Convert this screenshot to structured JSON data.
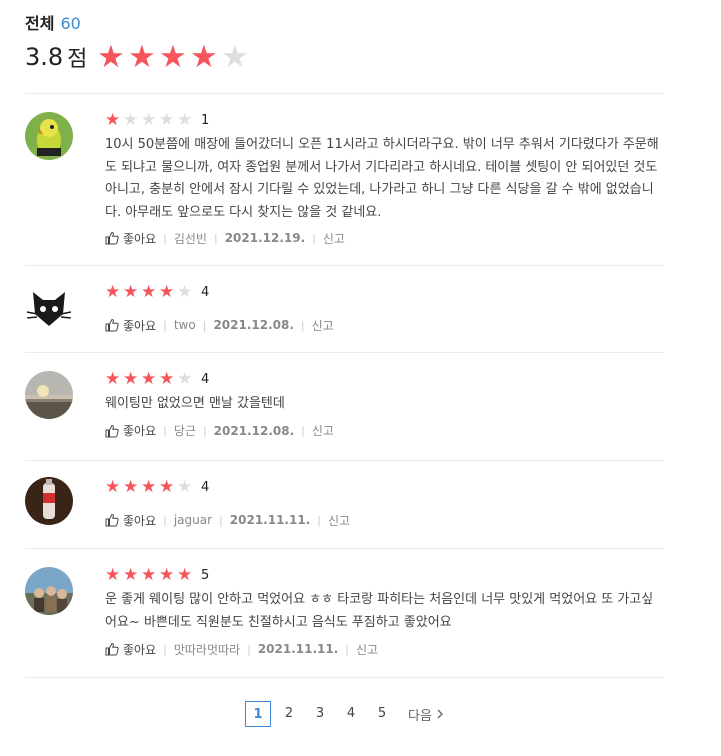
{
  "summary": {
    "label": "전체",
    "count": "60",
    "score": "3.8",
    "score_unit": "점",
    "stars_filled": 4
  },
  "reviews": [
    {
      "author": "김선빈",
      "rating": "1",
      "text": "10시 50분쯤에 매장에 들어갔더니 오픈 11시라고 하시더라구요. 밖이 너무 추워서 기다렸다가 주문해도 되냐고 물으니까, 여자 종업원 분께서 나가서 기다리라고 하시네요. 테이블 셋팅이 안 되어있던 것도 아니고, 충분히 안에서 잠시 기다릴 수 있었는데, 나가라고 하니 그냥 다른 식당을 갈 수 밖에 없었습니다. 아무래도 앞으로도 다시 찾지는 않을 것 같네요.",
      "like": "좋아요",
      "date": "2021.12.19.",
      "report": "신고",
      "avatar": "parrot"
    },
    {
      "author": "two",
      "rating": "4",
      "text": "",
      "like": "좋아요",
      "date": "2021.12.08.",
      "report": "신고",
      "avatar": "cat"
    },
    {
      "author": "당근",
      "rating": "4",
      "text": "웨이팅만 없었으면 맨날 갔을텐데",
      "like": "좋아요",
      "date": "2021.12.08.",
      "report": "신고",
      "avatar": "sunset"
    },
    {
      "author": "jaguar",
      "rating": "4",
      "text": "",
      "like": "좋아요",
      "date": "2021.11.11.",
      "report": "신고",
      "avatar": "bottle"
    },
    {
      "author": "맛따라멋따라",
      "rating": "5",
      "text": "운 좋게 웨이팅 많이 안하고 먹었어요 ㅎㅎ 타코랑 파히타는 처음인데 너무 맛있게 먹었어요 또 가고싶어요~ 바쁜데도 직원분도 친절하시고 음식도 푸짐하고 좋았어요",
      "like": "좋아요",
      "date": "2021.11.11.",
      "report": "신고",
      "avatar": "group"
    }
  ],
  "pagination": {
    "pages": [
      "1",
      "2",
      "3",
      "4",
      "5"
    ],
    "current": "1",
    "next_label": "다음"
  },
  "colors": {
    "star_on": "#f6555b",
    "star_off": "#dedede",
    "accent": "#3c8ad6"
  }
}
